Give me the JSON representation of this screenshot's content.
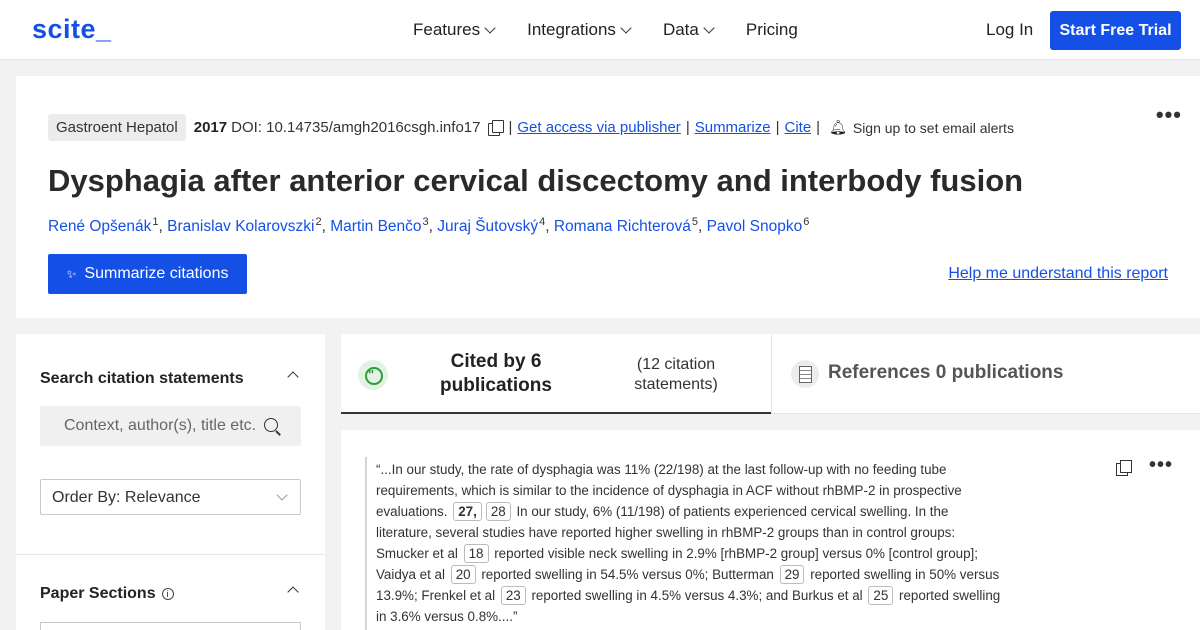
{
  "header": {
    "logo": "scite_",
    "nav": [
      {
        "label": "Features",
        "has_dropdown": true
      },
      {
        "label": "Integrations",
        "has_dropdown": true
      },
      {
        "label": "Data",
        "has_dropdown": true
      },
      {
        "label": "Pricing",
        "has_dropdown": false
      }
    ],
    "login_label": "Log In",
    "trial_label": "Start Free Trial"
  },
  "paper": {
    "journal": "Gastroent Hepatol",
    "year": "2017",
    "doi": "DOI: 10.14735/amgh2016csgh.info17",
    "links": {
      "access": "Get access via publisher",
      "summarize": "Summarize",
      "cite": "Cite"
    },
    "alerts": "Sign up to set email alerts",
    "title": "Dysphagia after anterior cervical discectomy and interbody fusion",
    "authors": [
      {
        "name": "René Opšenák",
        "sup": "1"
      },
      {
        "name": "Branislav Kolarovszki",
        "sup": "2"
      },
      {
        "name": "Martin Benčo",
        "sup": "3"
      },
      {
        "name": "Juraj Šutovský",
        "sup": "4"
      },
      {
        "name": "Romana Richterová",
        "sup": "5"
      },
      {
        "name": "Pavol Snopko",
        "sup": "6"
      }
    ],
    "summarize_button": "Summarize citations",
    "help_link": "Help me understand this report"
  },
  "sidebar": {
    "search_title": "Search citation statements",
    "search_placeholder": "Context, author(s), title etc.",
    "order_by": "Order By: Relevance",
    "sections_title": "Paper Sections"
  },
  "tabs": {
    "cited_by": "Cited by 6 publications",
    "cited_by_sub": "(12 citation statements)",
    "references": "References 0 publications"
  },
  "citation": {
    "segments": [
      {
        "t": "“...In our study, the rate of dysphagia was 11% (22/198) at the last follow-up with no feeding tube requirements, which is similar to the incidence of dysphagia in ACF without rhBMP-2 in prospective evaluations. "
      },
      {
        "ref": "27,",
        "bold": true
      },
      {
        "ref": "28"
      },
      {
        "t": " In our study, 6% (11/198) of patients experienced cervical swelling. In the literature, several studies have reported higher swelling in rhBMP-2 groups than in control groups: Smucker et al "
      },
      {
        "ref": "18"
      },
      {
        "t": " reported visible neck swelling in 2.9% [rhBMP-2 group] versus 0% [control group]; Vaidya et al "
      },
      {
        "ref": "20"
      },
      {
        "t": " reported swelling in 54.5% versus 0%; Butterman "
      },
      {
        "ref": "29"
      },
      {
        "t": " reported swelling in 50% versus 13.9%; Frenkel et al "
      },
      {
        "ref": "23"
      },
      {
        "t": " reported swelling in 4.5% versus 4.3%; and Burkus et al "
      },
      {
        "ref": "25"
      },
      {
        "t": " reported swelling in 3.6% versus 0.8%....”"
      }
    ]
  }
}
